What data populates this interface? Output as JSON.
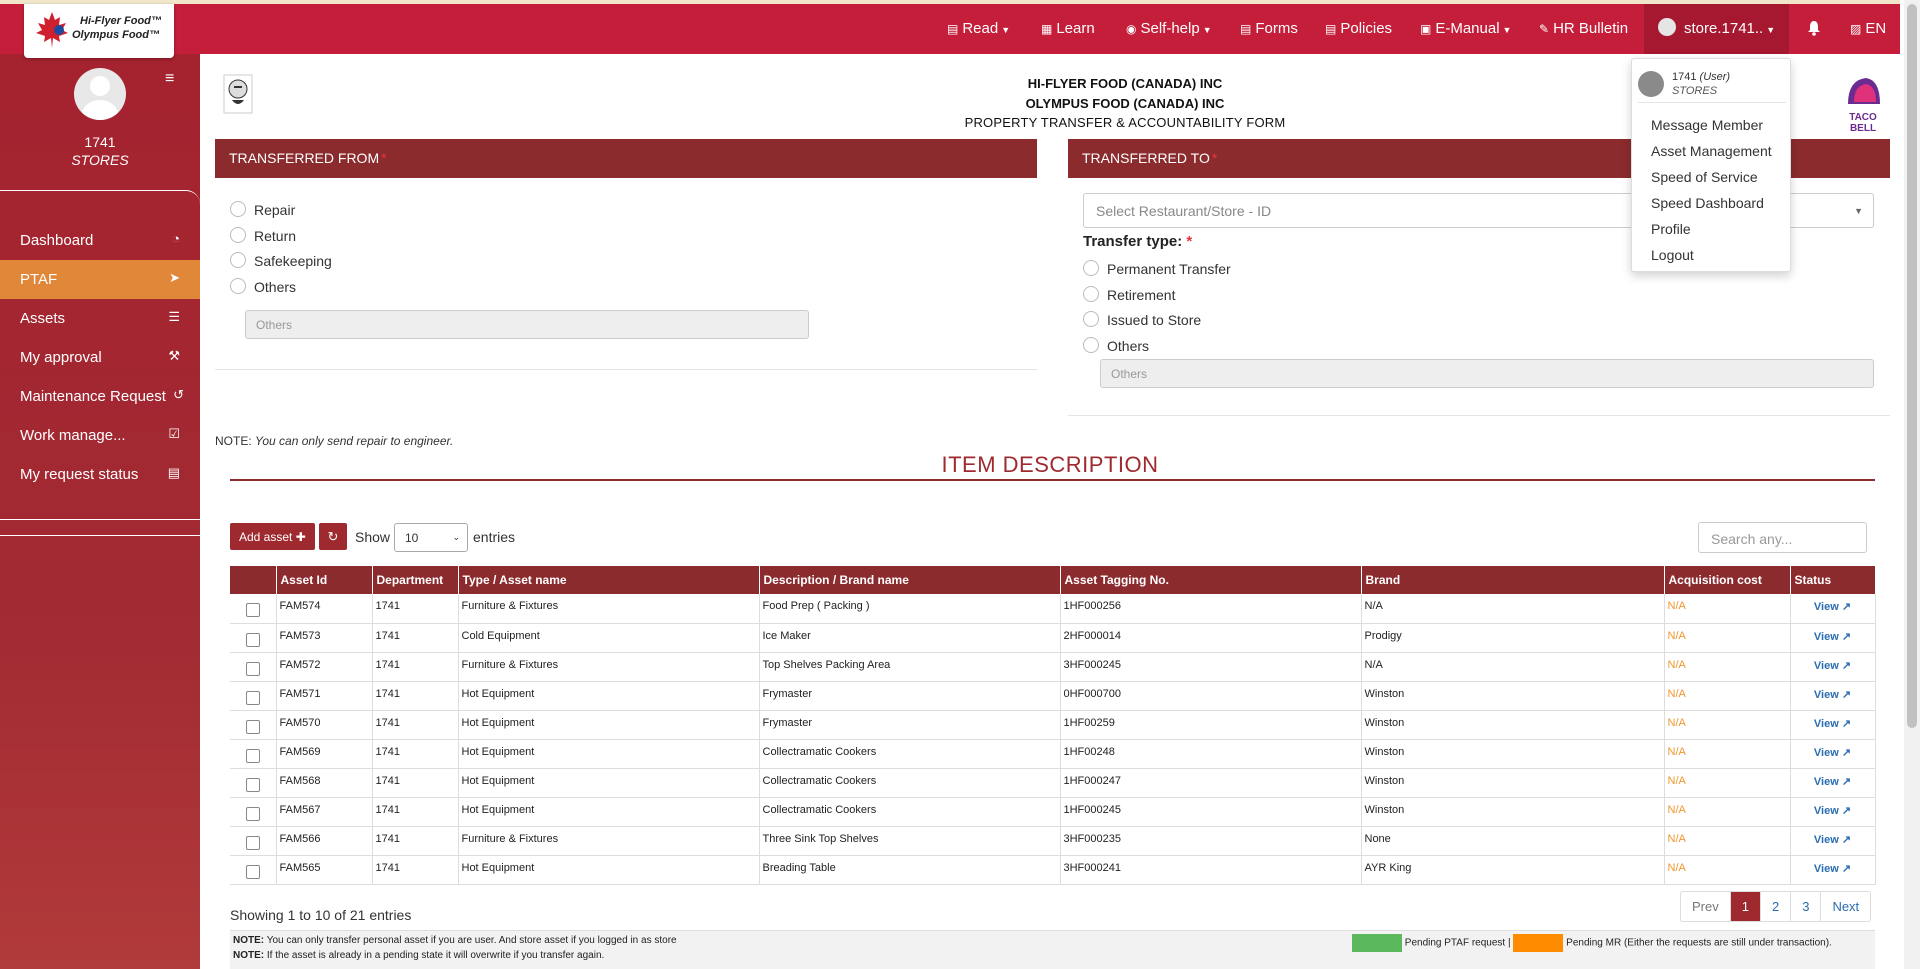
{
  "brand": {
    "line1": "Hi-Flyer Food™",
    "line2": "Olympus Food™"
  },
  "nav": [
    {
      "label": "Read",
      "icon": "reader-icon",
      "caret": true
    },
    {
      "label": "Learn",
      "icon": "book-icon",
      "caret": false
    },
    {
      "label": "Self-help",
      "icon": "lifebuoy-icon",
      "caret": true
    },
    {
      "label": "Forms",
      "icon": "forms-icon",
      "caret": false
    },
    {
      "label": "Policies",
      "icon": "policies-icon",
      "caret": false
    },
    {
      "label": "E-Manual",
      "icon": "manual-icon",
      "caret": true
    },
    {
      "label": "HR Bulletin",
      "icon": "pin-icon",
      "caret": false
    }
  ],
  "user_menu": {
    "label": "store.1741..",
    "user_id": "1741",
    "user_type": "(User)",
    "role": "STORES",
    "items": [
      "Message Member",
      "Asset Management",
      "Speed of Service",
      "Speed Dashboard",
      "Profile",
      "Logout"
    ]
  },
  "lang": "EN",
  "sidebar": {
    "name": "1741",
    "role": "STORES",
    "items": [
      {
        "label": "Dashboard",
        "icon": "dashboard-icon"
      },
      {
        "label": "PTAF",
        "icon": "send-icon",
        "active": true
      },
      {
        "label": "Assets",
        "icon": "list-icon"
      },
      {
        "label": "My approval",
        "icon": "gavel-icon"
      },
      {
        "label": "Maintenance Request",
        "icon": "history-icon"
      },
      {
        "label": "Work manage...",
        "icon": "calendar-check-icon"
      },
      {
        "label": "My request status",
        "icon": "document-icon"
      }
    ]
  },
  "header": {
    "company1": "HI-FLYER FOOD (CANADA) INC",
    "company2": "OLYMPUS FOOD (CANADA) INC",
    "form_title": "PROPERTY TRANSFER & ACCOUNTABILITY FORM"
  },
  "transferred_from": {
    "title": "TRANSFERRED FROM",
    "required": "*",
    "options": [
      "Repair",
      "Return",
      "Safekeeping",
      "Others"
    ],
    "others_placeholder": "Others"
  },
  "transferred_to": {
    "title": "TRANSFERRED TO",
    "required": "*",
    "store_placeholder": "Select Restaurant/Store - ID",
    "transfer_type_label": "Transfer type:",
    "options": [
      "Permanent Transfer",
      "Retirement",
      "Issued to Store",
      "Others"
    ],
    "others_placeholder": "Others"
  },
  "note_repair": {
    "label": "NOTE:",
    "text": "You can only send repair to engineer."
  },
  "item_description": "ITEM DESCRIPTION",
  "toolbar": {
    "add_asset": "Add asset",
    "show": "Show",
    "entries_value": "10",
    "entries": "entries",
    "search_placeholder": "Search any..."
  },
  "table": {
    "columns": [
      "Asset Id",
      "Department",
      "Type / Asset name",
      "Description / Brand name",
      "Asset Tagging No.",
      "Brand",
      "Acquisition cost",
      "Status"
    ],
    "rows": [
      [
        "FAM574",
        "1741",
        "Furniture & Fixtures",
        "Food Prep ( Packing )",
        "1HF000256",
        "N/A",
        "N/A",
        "View"
      ],
      [
        "FAM573",
        "1741",
        "Cold Equipment",
        "Ice Maker",
        "2HF000014",
        "Prodigy",
        "N/A",
        "View"
      ],
      [
        "FAM572",
        "1741",
        "Furniture & Fixtures",
        "Top Shelves Packing Area",
        "3HF000245",
        "N/A",
        "N/A",
        "View"
      ],
      [
        "FAM571",
        "1741",
        "Hot Equipment",
        "Frymaster",
        "0HF000700",
        "Winston",
        "N/A",
        "View"
      ],
      [
        "FAM570",
        "1741",
        "Hot Equipment",
        "Frymaster",
        "1HF00259",
        "Winston",
        "N/A",
        "View"
      ],
      [
        "FAM569",
        "1741",
        "Hot Equipment",
        "Collectramatic Cookers",
        "1HF00248",
        "Winston",
        "N/A",
        "View"
      ],
      [
        "FAM568",
        "1741",
        "Hot Equipment",
        "Collectramatic Cookers",
        "1HF000247",
        "Winston",
        "N/A",
        "View"
      ],
      [
        "FAM567",
        "1741",
        "Hot Equipment",
        "Collectramatic Cookers",
        "1HF000245",
        "Winston",
        "N/A",
        "View"
      ],
      [
        "FAM566",
        "1741",
        "Furniture & Fixtures",
        "Three Sink Top Shelves",
        "3HF000235",
        "None",
        "N/A",
        "View"
      ],
      [
        "FAM565",
        "1741",
        "Hot Equipment",
        "Breading Table",
        "3HF000241",
        "AYR King",
        "N/A",
        "View"
      ]
    ]
  },
  "showing": "Showing 1 to 10 of 21 entries",
  "pagination": {
    "prev": "Prev",
    "pages": [
      "1",
      "2",
      "3"
    ],
    "current": "1",
    "next": "Next"
  },
  "footer": {
    "note1_label": "NOTE:",
    "note1": "You can only transfer personal asset if you are user. And store asset if you logged in as store",
    "note2_label": "NOTE:",
    "note2": "If the asset is already in a pending state it will overwrite if you transfer again.",
    "legend_ptaf": "Pending PTAF request |",
    "legend_mr": "Pending MR (Either the requests are still under transaction).",
    "color_ptaf": "#5cb85c",
    "color_mr": "#ff8c00"
  },
  "colors": {
    "topbar": "#c41e3a",
    "panel": "#8b2b2e",
    "active": "#e0873a"
  }
}
